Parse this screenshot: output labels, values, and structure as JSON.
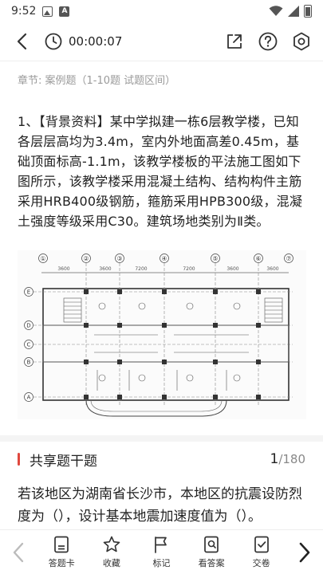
{
  "status_bar": {
    "time": "9:52"
  },
  "header": {
    "timer": "00:00:07"
  },
  "chapter": {
    "label": "章节: 案例题（1-10题 试题区间）"
  },
  "question": {
    "text": "1、【背景资料】某中学拟建一栋6层教学楼，已知各层层高均为3.4m，室内外地面高差0.45m，基础顶面标高-1.1m，该教学楼板的平法施工图如下图所示，该教学楼采用混凝土结构、结构构件主筋采用HRB400级钢筋，箍筋采用HPB300级，混凝土强度等级采用C30。建筑场地类别为Ⅱ类。"
  },
  "figure": {
    "col_axes": [
      "①",
      "②",
      "③",
      "④",
      "⑤",
      "⑥",
      "⑦"
    ],
    "row_axes": [
      "E",
      "D",
      "C",
      "B",
      "A"
    ],
    "span_labels": [
      "3600",
      "3600",
      "7200",
      "7200",
      "3600",
      "3600"
    ]
  },
  "section": {
    "title": "共享题干题",
    "current": "1",
    "total": "/180"
  },
  "sub_question": {
    "text": "若该地区为湖南省长沙市，本地区的抗震设防烈度为（），设计基本地震加速度值为（）。"
  },
  "bottom_bar": {
    "tools": [
      {
        "label": "答题卡"
      },
      {
        "label": "收藏"
      },
      {
        "label": "标记"
      },
      {
        "label": "看答案"
      },
      {
        "label": "交卷"
      }
    ]
  }
}
